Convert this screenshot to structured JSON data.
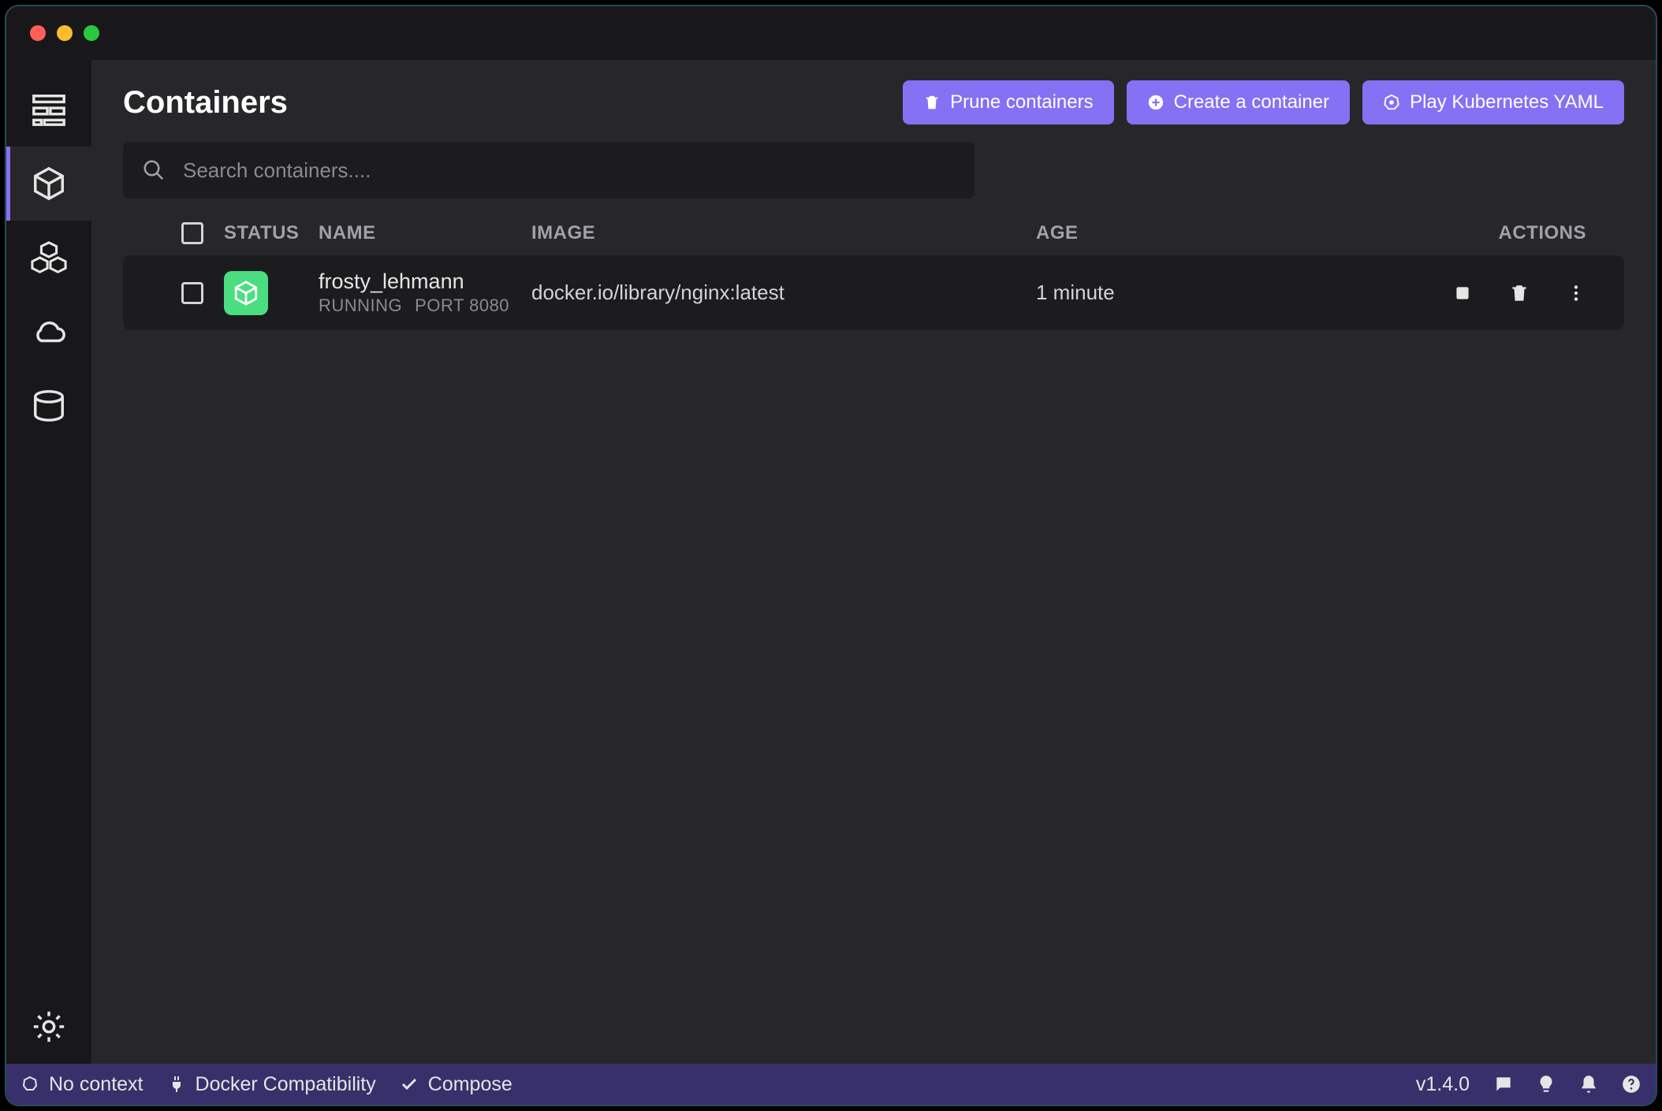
{
  "header": {
    "title": "Containers",
    "actions": {
      "prune": "Prune containers",
      "create": "Create a container",
      "kube": "Play Kubernetes YAML"
    }
  },
  "search": {
    "placeholder": "Search containers...."
  },
  "table": {
    "columns": {
      "status": "STATUS",
      "name": "NAME",
      "image": "IMAGE",
      "age": "AGE",
      "actions": "ACTIONS"
    },
    "rows": [
      {
        "name": "frosty_lehmann",
        "state": "RUNNING",
        "port": "PORT 8080",
        "image": "docker.io/library/nginx:latest",
        "age": "1 minute"
      }
    ]
  },
  "statusbar": {
    "context": "No context",
    "docker": "Docker Compatibility",
    "compose": "Compose",
    "version": "v1.4.0"
  }
}
